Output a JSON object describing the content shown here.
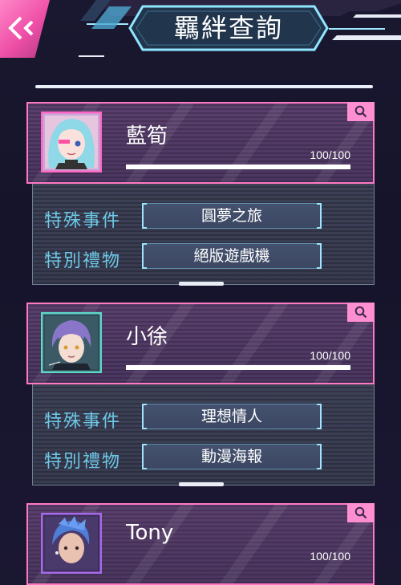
{
  "header": {
    "title": "羈絆查詢",
    "back_icon": "double-chevron-left-icon"
  },
  "colors": {
    "accent_pink": "#ff78c2",
    "label_cyan": "#6cc8e6",
    "card_bg": "#4a3660",
    "panel_bg": "#3a3d52"
  },
  "labels": {
    "event": "特殊事件",
    "gift": "特別禮物"
  },
  "characters": [
    {
      "name": "藍筍",
      "progress_text": "100/100",
      "progress": 1.0,
      "event_value": "圓夢之旅",
      "gift_value": "絕版遊戲機",
      "avatar_icon": "avatar-lan-sun",
      "frame_color": "#ff67c4"
    },
    {
      "name": "小徐",
      "progress_text": "100/100",
      "progress": 1.0,
      "event_value": "理想情人",
      "gift_value": "動漫海報",
      "avatar_icon": "avatar-xiao-xu",
      "frame_color": "#5fd6c8"
    },
    {
      "name": "Tony",
      "progress_text": "100/100",
      "progress": 1.0,
      "avatar_icon": "avatar-tony",
      "frame_color": "#a86ae8"
    }
  ]
}
